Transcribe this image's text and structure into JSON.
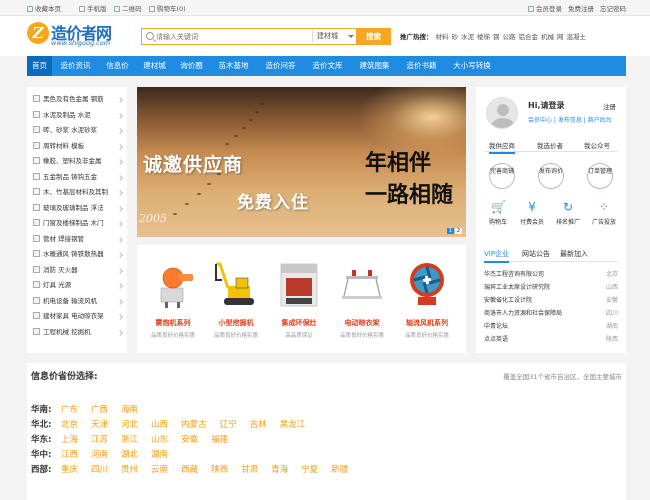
{
  "topbar": {
    "left": [
      "收藏本页",
      "手机版",
      "二维码",
      "购物车(0)"
    ],
    "right": [
      "会员登录",
      "免费注册",
      "忘记密码"
    ]
  },
  "logo": {
    "name": "造价者网",
    "domain": "www.shigoog.com"
  },
  "search": {
    "placeholder": "请输入关键词",
    "category": "建材城",
    "button": "搜索"
  },
  "hot": {
    "label": "推广热搜：",
    "items": [
      "材料",
      "砂",
      "水泥",
      "楼梯",
      "钢",
      "公路",
      "铝合金",
      "机械",
      "网",
      "混凝土"
    ]
  },
  "nav": [
    "首页",
    "造价资讯",
    "信息价",
    "建材城",
    "询价圈",
    "苗木基地",
    "造价问答",
    "造价文库",
    "建筑图集",
    "造价书籍",
    "大小写转换"
  ],
  "sidebar": [
    "黑色及有色金属 钢筋",
    "水泥及制品 水泥",
    "砖、砂浆 水泥砂浆",
    "周转材料 模板",
    "橡胶、塑料及非金属",
    "五金制品 铸钩五金",
    "木、竹基层材料及其制",
    "玻璃及玻璃制品 浮法",
    "门窗及楼梯制品 木门",
    "管材 焊接钢管",
    "水暖通风 铸铁散热器",
    "消防 灭火器",
    "灯具 光源",
    "机电设备 输流风机",
    "建材家具 电动晾衣架",
    "工程机械 挖掘机"
  ],
  "banner": {
    "line1": "诚邀供应商",
    "line2": "免费入住",
    "calligraphy1": "年相伴",
    "calligraphy2": "一路相随",
    "year": "2005",
    "pages": [
      "1",
      "2"
    ]
  },
  "products": [
    {
      "title": "雾炮机系列",
      "sub": "品质良好价格实惠"
    },
    {
      "title": "小型挖掘机",
      "sub": "品质良好价格实惠"
    },
    {
      "title": "集成环保灶",
      "sub": "高品质保证"
    },
    {
      "title": "电动晾衣架",
      "sub": "品质良好价格实惠"
    },
    {
      "title": "轴流风机系列",
      "sub": "品质良好价格实惠"
    }
  ],
  "login": {
    "greeting": "Hi,请登录",
    "register": "注册",
    "links": "会员中心 | 发布信息 | 商户后台",
    "tabs": [
      "我供应商",
      "我选价者",
      "我公众号"
    ],
    "circles": [
      "完善商铺",
      "发布询价",
      "订单管理"
    ],
    "icons": [
      {
        "icon": "cart-icon",
        "label": "购物车"
      },
      {
        "icon": "money-icon",
        "label": "付费会员"
      },
      {
        "icon": "rank-icon",
        "label": "排名推广"
      },
      {
        "icon": "ad-icon",
        "label": "广告投放"
      }
    ],
    "list_tabs": [
      "VIP企业",
      "网站公告",
      "最新加入"
    ],
    "companies": [
      {
        "name": "华杰工程咨询有限公司",
        "region": "北京"
      },
      {
        "name": "瑞宾工业太原设计研究院",
        "region": "山西"
      },
      {
        "name": "安徽省化工设计院",
        "region": "安徽"
      },
      {
        "name": "商洛市人力资源和社会保障局",
        "region": "四川"
      },
      {
        "name": "中青论坛",
        "region": "湖南"
      },
      {
        "name": "点点英语",
        "region": "陕西"
      }
    ]
  },
  "regions": {
    "title": "信息价省份选择:",
    "note": "覆盖全国31个省市自治区，全国主要城市",
    "rows": [
      {
        "name": "华南:",
        "provinces": [
          "广东",
          "广西",
          "海南"
        ]
      },
      {
        "name": "华北:",
        "provinces": [
          "北京",
          "天津",
          "河北",
          "山西",
          "内蒙古",
          "辽宁",
          "吉林",
          "黑龙江"
        ]
      },
      {
        "name": "华东:",
        "provinces": [
          "上海",
          "江苏",
          "浙江",
          "山东",
          "安徽",
          "福建"
        ]
      },
      {
        "name": "华中:",
        "provinces": [
          "江西",
          "河南",
          "湖北",
          "湖南"
        ]
      },
      {
        "name": "西部:",
        "provinces": [
          "重庆",
          "四川",
          "贵州",
          "云南",
          "西藏",
          "陕西",
          "甘肃",
          "青海",
          "宁夏",
          "新疆"
        ]
      }
    ]
  },
  "colors": {
    "primary": "#1f8be1",
    "accent": "#f5a623",
    "province": "#f39c12",
    "product_title": "#e43b1a"
  }
}
